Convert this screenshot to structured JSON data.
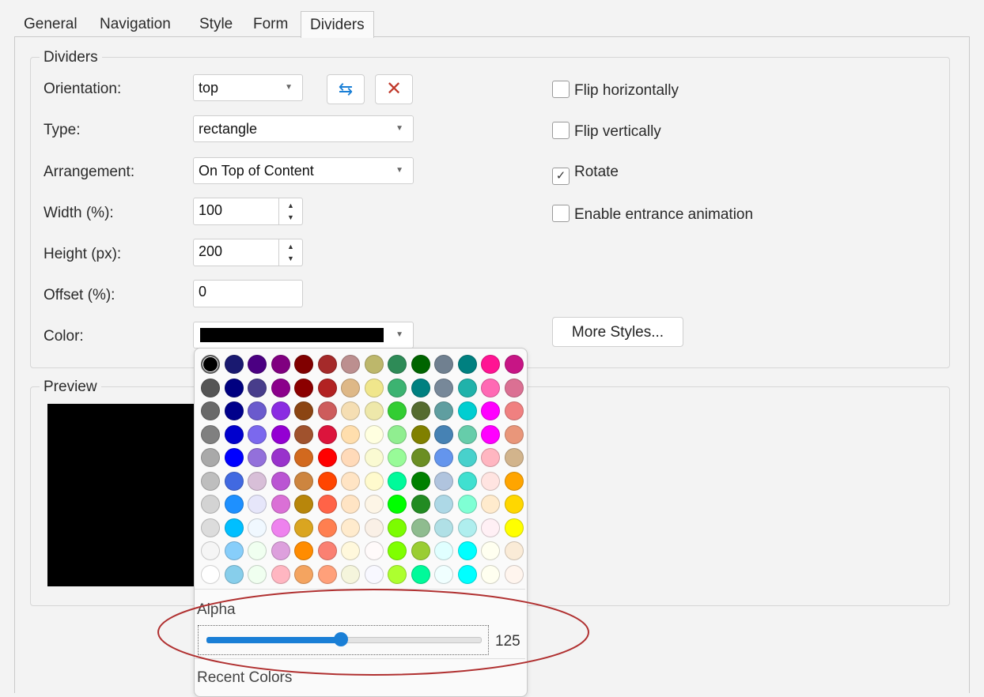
{
  "tabs": [
    {
      "label": "General",
      "active": false
    },
    {
      "label": "Navigation",
      "active": false
    },
    {
      "label": "Style",
      "active": false
    },
    {
      "label": "Form",
      "active": false
    },
    {
      "label": "Dividers",
      "active": true
    }
  ],
  "dividers_group": {
    "legend": "Dividers",
    "orientation": {
      "label": "Orientation:",
      "value": "top"
    },
    "type": {
      "label": "Type:",
      "value": "rectangle"
    },
    "arrangement": {
      "label": "Arrangement:",
      "value": "On Top of Content"
    },
    "width": {
      "label": "Width (%):",
      "value": "100"
    },
    "height": {
      "label": "Height (px):",
      "value": "200"
    },
    "offset": {
      "label": "Offset (%):",
      "value": "0"
    },
    "color": {
      "label": "Color:",
      "value": "#000000"
    },
    "swap_icon": "swap-arrows-icon",
    "remove_icon": "close-icon",
    "checkboxes": [
      {
        "label": "Flip horizontally",
        "checked": false
      },
      {
        "label": "Flip vertically",
        "checked": false
      },
      {
        "label": "Rotate",
        "checked": true
      },
      {
        "label": "Enable entrance animation",
        "checked": false
      }
    ],
    "more_styles": "More Styles..."
  },
  "preview_group": {
    "legend": "Preview",
    "fill": "#000000"
  },
  "color_picker": {
    "alpha_label": "Alpha",
    "alpha_value": "125",
    "alpha_fraction": 0.49,
    "recent_label": "Recent Colors",
    "palette": [
      [
        "#000000",
        "#191970",
        "#4b0082",
        "#800080",
        "#800000",
        "#a52a2a",
        "#bc8f8f",
        "#bdb76b",
        "#2e8b57",
        "#006400",
        "#708090",
        "#008080",
        "#ff1493",
        "#c71585"
      ],
      [
        "#555555",
        "#000080",
        "#483d8b",
        "#8b008b",
        "#8b0000",
        "#b22222",
        "#deb887",
        "#f0e68c",
        "#3cb371",
        "#008080",
        "#778899",
        "#20b2aa",
        "#ff69b4",
        "#db7093"
      ],
      [
        "#696969",
        "#00008b",
        "#6a5acd",
        "#8a2be2",
        "#8b4513",
        "#cd5c5c",
        "#f5deb3",
        "#eee8aa",
        "#32cd32",
        "#556b2f",
        "#5f9ea0",
        "#00ced1",
        "#ff00ff",
        "#f08080"
      ],
      [
        "#808080",
        "#0000cd",
        "#7b68ee",
        "#9400d3",
        "#a0522d",
        "#dc143c",
        "#ffdead",
        "#ffffe0",
        "#90ee90",
        "#808000",
        "#4682b4",
        "#66cdaa",
        "#ff00ff",
        "#e9967a"
      ],
      [
        "#a9a9a9",
        "#0000ff",
        "#9370db",
        "#9932cc",
        "#d2691e",
        "#ff0000",
        "#ffdab9",
        "#fafad2",
        "#98fb98",
        "#6b8e23",
        "#6495ed",
        "#48d1cc",
        "#ffb6c1",
        "#d2b48c"
      ],
      [
        "#bebebe",
        "#4169e1",
        "#d8bfd8",
        "#ba55d3",
        "#cd853f",
        "#ff4500",
        "#ffe4c4",
        "#fffacd",
        "#00fa9a",
        "#008000",
        "#b0c4de",
        "#40e0d0",
        "#ffe4e1",
        "#ffa500"
      ],
      [
        "#d3d3d3",
        "#1e90ff",
        "#e6e6fa",
        "#da70d6",
        "#b8860b",
        "#ff6347",
        "#ffe4c4",
        "#fdf5e6",
        "#00ff00",
        "#228b22",
        "#add8e6",
        "#7fffd4",
        "#ffebcd",
        "#ffd700"
      ],
      [
        "#dcdcdc",
        "#00bfff",
        "#f0f8ff",
        "#ee82ee",
        "#daa520",
        "#ff7f50",
        "#ffebcd",
        "#faf0e6",
        "#7cfc00",
        "#8fbc8f",
        "#b0e0e6",
        "#afeeee",
        "#fff0f5",
        "#ffff00"
      ],
      [
        "#f5f5f5",
        "#87cefa",
        "#f0fff0",
        "#dda0dd",
        "#ff8c00",
        "#fa8072",
        "#fff8dc",
        "#fffafa",
        "#7fff00",
        "#9acd32",
        "#e0ffff",
        "#00ffff",
        "#fffff0",
        "#faebd7"
      ],
      [
        "#ffffff",
        "#87ceeb",
        "#f0fff0",
        "#ffb6c1",
        "#f4a460",
        "#ffa07a",
        "#f5f5dc",
        "#f8f8ff",
        "#adff2f",
        "#00fa9a",
        "#f0ffff",
        "#00ffff",
        "#fffff0",
        "#fff5ee"
      ]
    ]
  },
  "annotation": {
    "color": "#b03030"
  }
}
